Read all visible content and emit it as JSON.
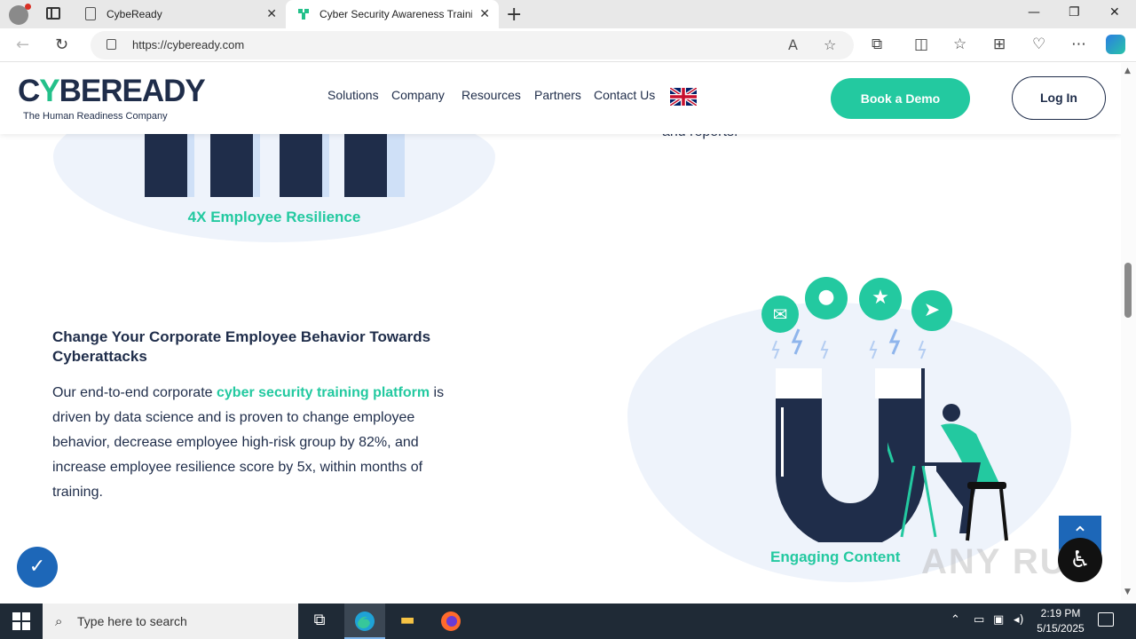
{
  "browser": {
    "tabs": [
      {
        "title": "CybeReady"
      },
      {
        "title": "Cyber Security Awareness Trainin"
      }
    ],
    "url": "https://cybeready.com"
  },
  "site": {
    "logo_text_prefix": "C",
    "logo_text_mark": "Y",
    "logo_text_suffix": "BEREADY",
    "logo_tagline": "The Human Readiness Company",
    "nav": [
      "Solutions",
      "Company",
      "Resources",
      "Partners",
      "Contact Us"
    ],
    "book_demo": "Book a Demo",
    "login": "Log In"
  },
  "content": {
    "stat_top": "4X Employee Resilience",
    "reports_fragment": "and reports.",
    "heading": "Change Your Corporate Employee Behavior Towards Cyberattacks",
    "para_prefix": "Our end-to-end corporate ",
    "para_link": "cyber security training platform",
    "para_suffix": " is driven by data science and is proven to change employee behavior, decrease employee high-risk group by 82%, and increase employee resilience score by 5x, within months of training.",
    "stat_bottom": "Engaging Content"
  },
  "overlay": {
    "watermark": "ANY RUN"
  },
  "taskbar": {
    "search_placeholder": "Type here to search",
    "time": "2:19 PM",
    "date": "5/15/2025"
  },
  "colors": {
    "brand_navy": "#1f2d4a",
    "brand_green": "#23c9a0"
  }
}
